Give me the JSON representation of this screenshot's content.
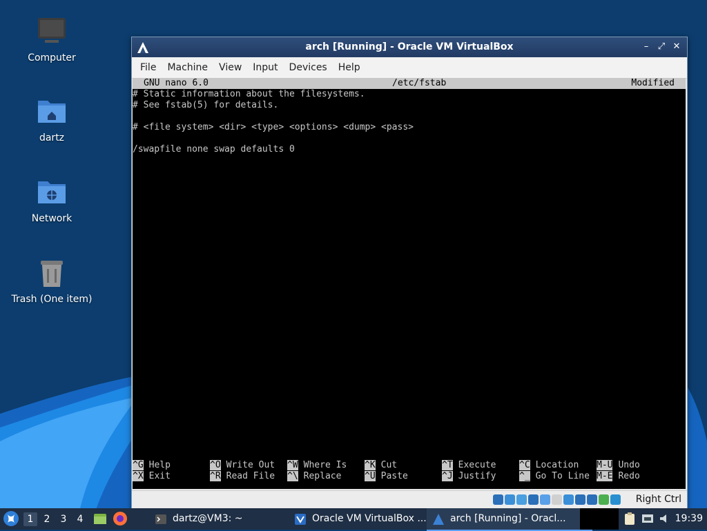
{
  "desktop": {
    "icons": [
      {
        "label": "Computer"
      },
      {
        "label": "dartz"
      },
      {
        "label": "Network"
      },
      {
        "label": "Trash (One item)"
      }
    ]
  },
  "window": {
    "title": "arch [Running] - Oracle VM VirtualBox",
    "menu": [
      "File",
      "Machine",
      "View",
      "Input",
      "Devices",
      "Help"
    ],
    "buttons": {
      "minimize": "–",
      "maximize": "⤢",
      "close": "✕"
    }
  },
  "nano": {
    "version": "GNU nano 6.0",
    "filename": "/etc/fstab",
    "status": "Modified",
    "lines": [
      "# Static information about the filesystems.",
      "# See fstab(5) for details.",
      "",
      "# <file system> <dir> <type> <options> <dump> <pass>",
      "",
      "/swapfile none swap defaults 0"
    ],
    "shortcuts_row1": [
      {
        "key": "^G",
        "label": "Help"
      },
      {
        "key": "^O",
        "label": "Write Out"
      },
      {
        "key": "^W",
        "label": "Where Is"
      },
      {
        "key": "^K",
        "label": "Cut"
      },
      {
        "key": "^T",
        "label": "Execute"
      },
      {
        "key": "^C",
        "label": "Location"
      },
      {
        "key": "M-U",
        "label": "Undo"
      }
    ],
    "shortcuts_row2": [
      {
        "key": "^X",
        "label": "Exit"
      },
      {
        "key": "^R",
        "label": "Read File"
      },
      {
        "key": "^\\",
        "label": "Replace"
      },
      {
        "key": "^U",
        "label": "Paste"
      },
      {
        "key": "^J",
        "label": "Justify"
      },
      {
        "key": "^_",
        "label": "Go To Line"
      },
      {
        "key": "M-E",
        "label": "Redo"
      }
    ]
  },
  "statusbar": {
    "host_key": "Right Ctrl"
  },
  "taskbar": {
    "workspaces": [
      "1",
      "2",
      "3",
      "4"
    ],
    "active_workspace": "1",
    "tasks": [
      {
        "label": "dartz@VM3: ~"
      },
      {
        "label": "Oracle VM VirtualBox ..."
      },
      {
        "label": "arch [Running] - Oracl..."
      }
    ],
    "clock": "19:39"
  },
  "colors": {
    "terminal_bg": "#000000",
    "terminal_fg": "#c8c8c8",
    "title_bg": "#213b63",
    "taskbar_bg": "#1f2f45",
    "accent": "#5aa0ff"
  }
}
